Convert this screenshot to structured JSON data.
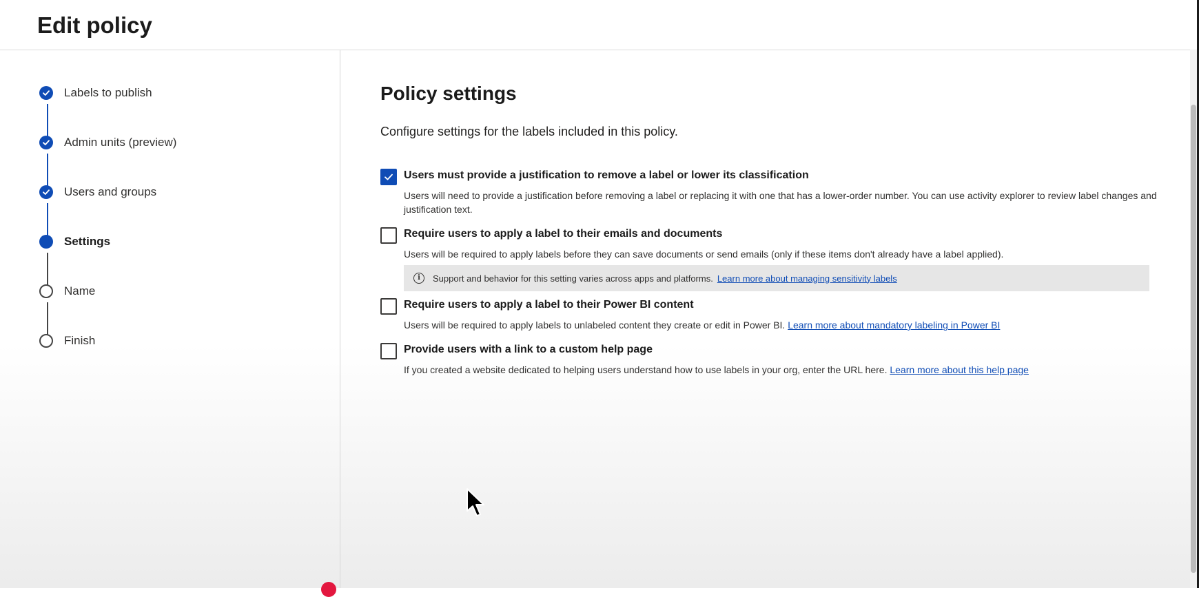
{
  "header": {
    "title": "Edit policy"
  },
  "steps": [
    {
      "label": "Labels to publish",
      "status": "done"
    },
    {
      "label": "Admin units (preview)",
      "status": "done"
    },
    {
      "label": "Users and groups",
      "status": "done"
    },
    {
      "label": "Settings",
      "status": "current"
    },
    {
      "label": "Name",
      "status": "todo"
    },
    {
      "label": "Finish",
      "status": "todo"
    }
  ],
  "main": {
    "title": "Policy settings",
    "description": "Configure settings for the labels included in this policy.",
    "options": [
      {
        "title": "Users must provide a justification to remove a label or lower its classification",
        "description": "Users will need to provide a justification before removing a label or replacing it with one that has a lower-order number. You can use activity explorer to review label changes and justification text.",
        "checked": true
      },
      {
        "title": "Require users to apply a label to their emails and documents",
        "description": "Users will be required to apply labels before they can save documents or send emails (only if these items don't already have a label applied).",
        "checked": false,
        "info": {
          "text": "Support and behavior for this setting varies across apps and platforms.",
          "link": "Learn more about managing sensitivity labels"
        }
      },
      {
        "title": "Require users to apply a label to their Power BI content",
        "description": "Users will be required to apply labels to unlabeled content they create or edit in Power BI.",
        "link": "Learn more about mandatory labeling in Power BI",
        "checked": false
      },
      {
        "title": "Provide users with a link to a custom help page",
        "description": "If you created a website dedicated to helping users understand how to use labels in your org, enter the URL here.",
        "link": "Learn more about this help page",
        "checked": false
      }
    ]
  },
  "colors": {
    "accent": "#0f4cb5",
    "info_bg": "#e6e6e6"
  }
}
